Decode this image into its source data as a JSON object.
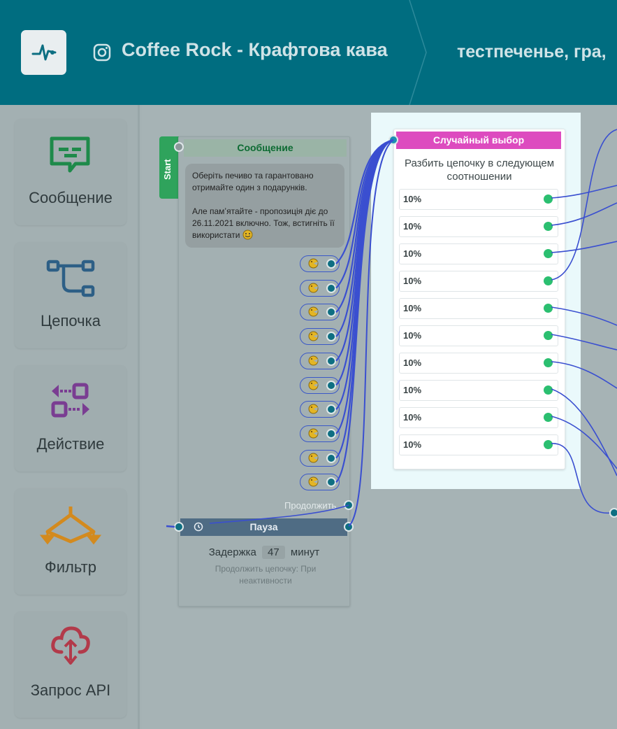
{
  "header": {
    "title": "Coffee Rock - Крафтова кава",
    "breadcrumb": "тестпеченье, гра,"
  },
  "sidebar": {
    "tools": [
      {
        "label": "Сообщение",
        "icon": "message-icon",
        "color": "#1e8a4a"
      },
      {
        "label": "Цепочка",
        "icon": "chain-icon",
        "color": "#2d5f86"
      },
      {
        "label": "Действие",
        "icon": "action-icon",
        "color": "#7a3d92"
      },
      {
        "label": "Фильтр",
        "icon": "filter-icon",
        "color": "#d38a1e"
      },
      {
        "label": "Запрос API",
        "icon": "api-icon",
        "color": "#b23a4a"
      }
    ]
  },
  "message_node": {
    "start_label": "Start",
    "title": "Сообщение",
    "text_lines": [
      "Оберіть печиво та гарантовано отримайте один з подарунків.",
      "Але памʼятайте - пропозиція діє до 26.11.2021 включно. Тож, встигніть її використати"
    ],
    "buttons_count": 10,
    "continue_label": "Продолжить"
  },
  "pause_node": {
    "title": "Пауза",
    "delay_prefix": "Задержка",
    "delay_value": "47",
    "delay_unit": "минут",
    "continue_condition": "Продолжить цепочку: При неактивности"
  },
  "random_node": {
    "title": "Случайный выбор",
    "description": "Разбить цепочку в следующем соотношении",
    "ratios": [
      "10%",
      "10%",
      "10%",
      "10%",
      "10%",
      "10%",
      "10%",
      "10%",
      "10%",
      "10%"
    ]
  },
  "colors": {
    "header_bg": "#006d80",
    "accent_pink": "#dd4bbf",
    "wire": "#3a4fd0",
    "port_green": "#2bbf70"
  }
}
